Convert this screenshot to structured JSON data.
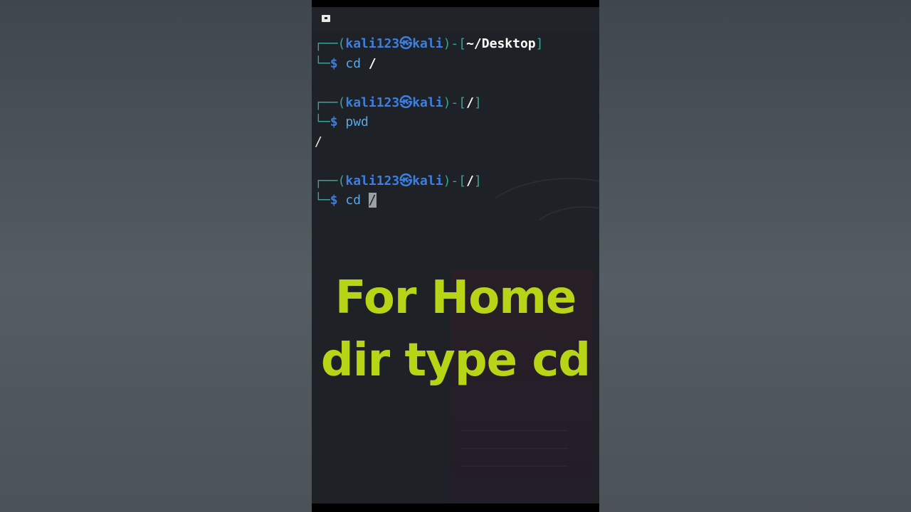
{
  "window": {
    "tab_icon": "terminal-icon"
  },
  "terminal": {
    "blocks": [
      {
        "user": "kali123",
        "host": "kali",
        "sep_symbol": "㉿",
        "cwd": "~/Desktop",
        "prompt": "$",
        "command": "cd",
        "arg": "/",
        "output": ""
      },
      {
        "user": "kali123",
        "host": "kali",
        "sep_symbol": "㉿",
        "cwd": "/",
        "prompt": "$",
        "command": "pwd",
        "arg": "",
        "output": "/"
      },
      {
        "user": "kali123",
        "host": "kali",
        "sep_symbol": "㉿",
        "cwd": "/",
        "prompt": "$",
        "command": "cd",
        "arg": "/",
        "output": ""
      }
    ]
  },
  "overlay": {
    "line1": "For Home",
    "line2": "dir type cd",
    "color": "#b8d416"
  },
  "colors": {
    "frame": "#3aa19b",
    "user": "#3d7fe0",
    "background": "#1e2126"
  }
}
